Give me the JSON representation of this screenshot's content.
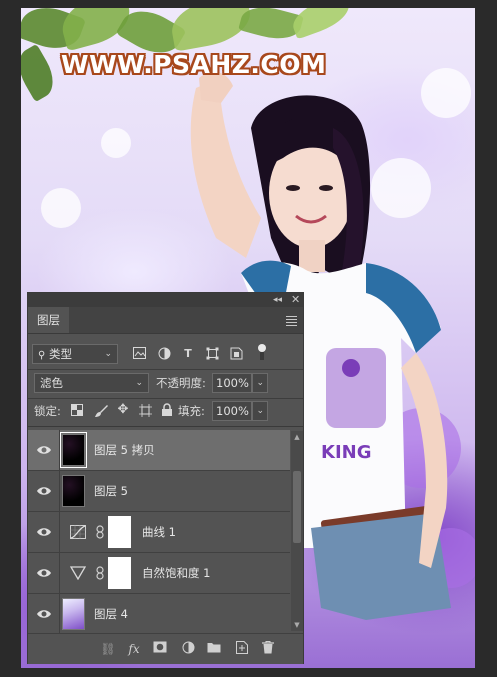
{
  "watermark": "WWW.PSAHZ.COM",
  "panel": {
    "tab_title": "图层",
    "filter_kind": "类型",
    "blend_mode": "滤色",
    "opacity_label": "不透明度:",
    "opacity_value": "100%",
    "lock_label": "锁定:",
    "fill_label": "填充:",
    "fill_value": "100%",
    "layers": [
      {
        "name": "图层 5 拷贝",
        "thumb": "black",
        "selected": true,
        "visible": true
      },
      {
        "name": "图层 5",
        "thumb": "black",
        "selected": false,
        "visible": true
      },
      {
        "name": "曲线 1",
        "thumb": "curves-adjustment",
        "selected": false,
        "visible": true
      },
      {
        "name": "自然饱和度 1",
        "thumb": "vibrance-adjustment",
        "selected": false,
        "visible": true
      },
      {
        "name": "图层 4",
        "thumb": "photo",
        "selected": false,
        "visible": true
      }
    ],
    "colors": {
      "panel_bg": "#535353",
      "selected_row": "#6e6e6e",
      "watermark_outline": "#a8481c"
    }
  }
}
